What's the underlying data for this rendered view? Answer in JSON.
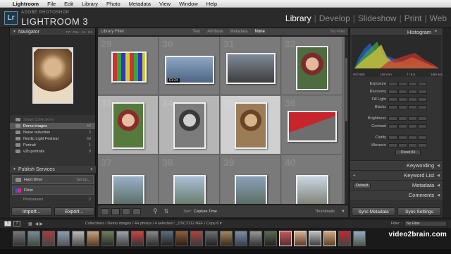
{
  "menubar": {
    "apple": "",
    "items": [
      "Lightroom",
      "File",
      "Edit",
      "Library",
      "Photo",
      "Metadata",
      "View",
      "Window",
      "Help"
    ]
  },
  "identity": {
    "logo": "Lr",
    "sub": "ADOBE PHOTOSHOP",
    "main": "LIGHTROOM 3"
  },
  "modules": [
    "Library",
    "Develop",
    "Slideshow",
    "Print",
    "Web"
  ],
  "active_module": "Library",
  "left": {
    "navigator": {
      "title": "Navigator",
      "zoom": [
        "FIT",
        "FILL",
        "1:1",
        "3:1"
      ]
    },
    "folders": [
      {
        "label": "Smart Collections",
        "count": ""
      },
      {
        "label": "Demo images",
        "count": "44"
      },
      {
        "label": "Noise reduction",
        "count": "3"
      },
      {
        "label": "Nordic Light Festival",
        "count": "69"
      },
      {
        "label": "Portrait",
        "count": "1"
      },
      {
        "label": "v2b portraits",
        "count": "9"
      }
    ],
    "publish": {
      "title": "Publish Services",
      "services": [
        {
          "name": "Hard Drive",
          "side": "Set Up...",
          "sub": []
        },
        {
          "name": "Flickr",
          "side": "",
          "sub": [
            {
              "name": "Photostream",
              "count": "2"
            }
          ]
        }
      ]
    },
    "buttons": [
      "Import...",
      "Export..."
    ]
  },
  "filter": {
    "label": "Library Filter :",
    "tabs": [
      "Text",
      "Attribute",
      "Metadata",
      "None"
    ],
    "active": "None",
    "preset": "No Filter"
  },
  "grid": {
    "indices": [
      "29",
      "30",
      "31",
      "32",
      "33",
      "34",
      "35",
      "36",
      "37",
      "38",
      "39",
      "40"
    ],
    "badge": "01:24"
  },
  "toolbar": {
    "sort_label": "Sort:",
    "sort_value": "Capture Time",
    "thumbnails_label": "Thumbnails"
  },
  "right": {
    "histogram": {
      "title": "Histogram",
      "iso": "ISO 800",
      "focal": "102 mm",
      "aperture": "f / 5.6",
      "shutter": "1/60 sec"
    },
    "quick_develop": [
      "Exposure",
      "Recovery",
      "Fill Light",
      "Blacks",
      "Brightness",
      "Contrast",
      "Clarity",
      "Vibrance"
    ],
    "reset_all": "Reset All",
    "panels": [
      "Keywording",
      "Keyword List",
      "Metadata",
      "Comments"
    ],
    "metadata_preset": "Default",
    "buttons": [
      "Sync Metadata",
      "Sync Settings"
    ]
  },
  "filmbar": {
    "monitor_1": "1",
    "monitor_2": "2",
    "breadcrumb": "Collections / Demo images / 44 photos / 4 selected / _DSC2112.NEF / Copy 6 ▾",
    "filter_label": "Filter :",
    "filter_value": "No Filter"
  },
  "watermark": "video2brain.com",
  "colors": {
    "accent": "#ffffff",
    "panel": "#333333",
    "grid": "#6f6f6f"
  }
}
